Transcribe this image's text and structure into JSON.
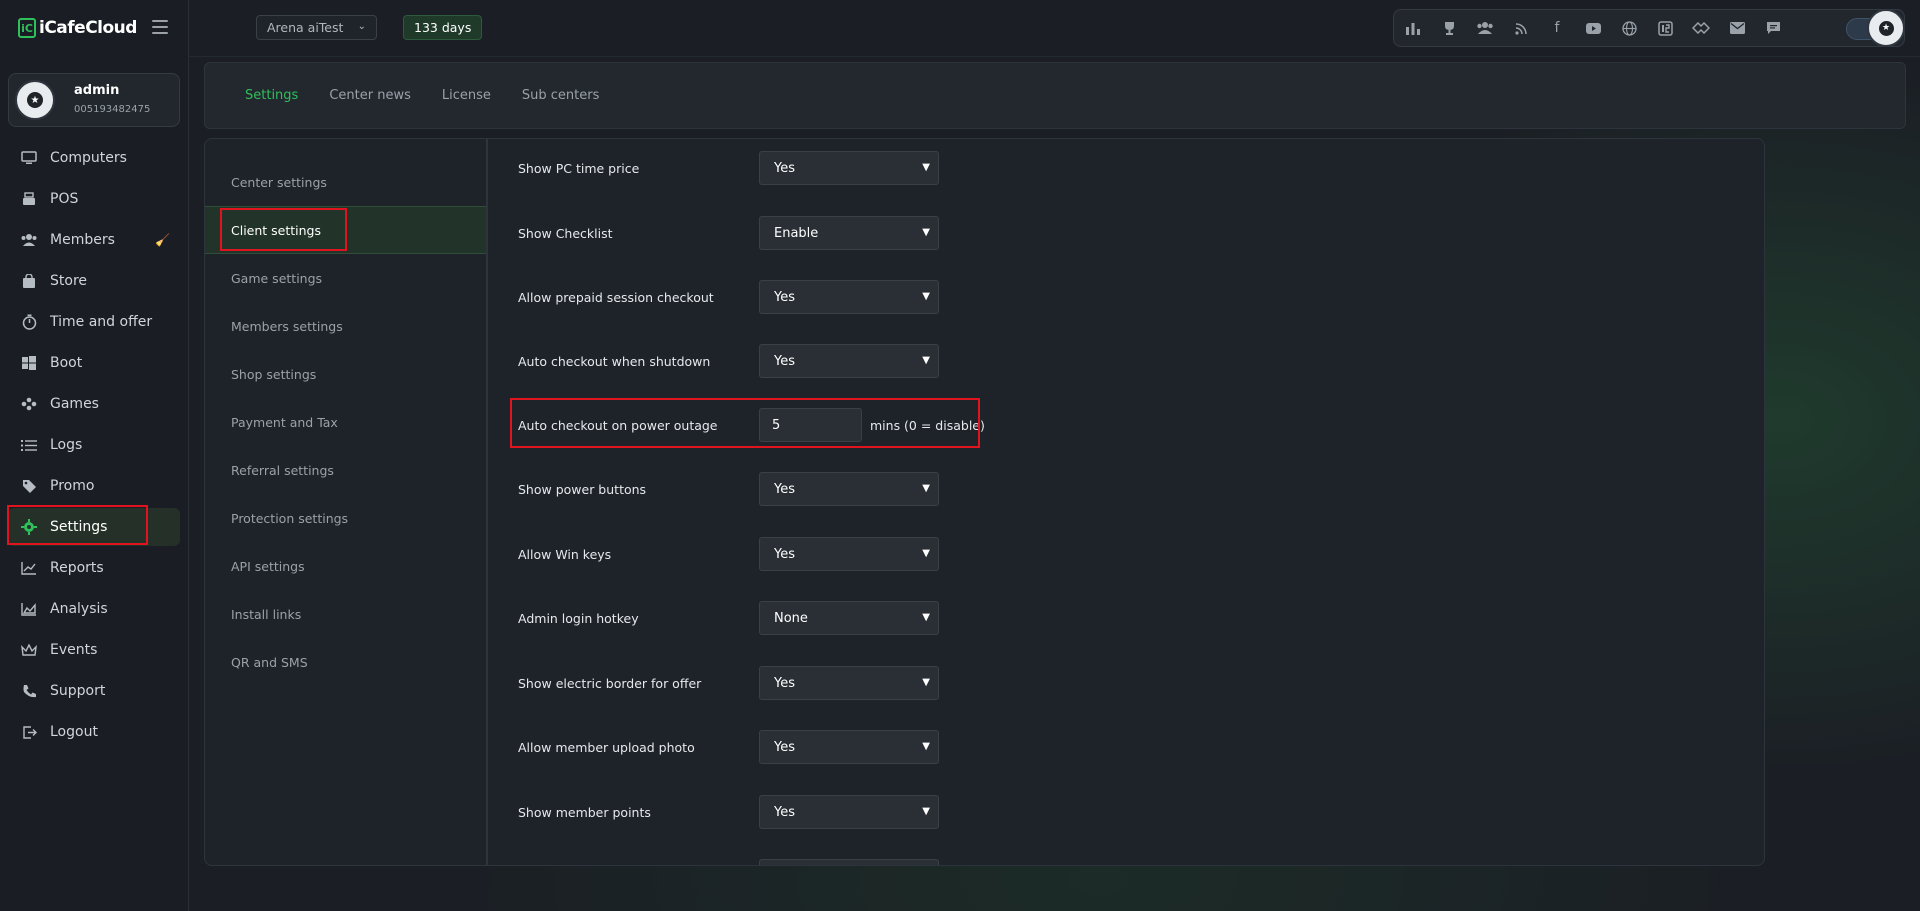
{
  "brand": {
    "mark": "iC",
    "name": "iCafeCloud"
  },
  "user": {
    "name": "admin",
    "id": "005193482475"
  },
  "nav": [
    {
      "label": "Computers",
      "icon": "monitor-icon"
    },
    {
      "label": "POS",
      "icon": "cash-register-icon"
    },
    {
      "label": "Members",
      "icon": "users-icon"
    },
    {
      "label": "Store",
      "icon": "shopping-bag-icon"
    },
    {
      "label": "Time and offer",
      "icon": "stopwatch-icon"
    },
    {
      "label": "Boot",
      "icon": "windows-icon"
    },
    {
      "label": "Games",
      "icon": "gamepad-icon"
    },
    {
      "label": "Logs",
      "icon": "list-icon"
    },
    {
      "label": "Promo",
      "icon": "tag-icon"
    },
    {
      "label": "Settings",
      "icon": "gear-icon"
    },
    {
      "label": "Reports",
      "icon": "line-chart-icon"
    },
    {
      "label": "Analysis",
      "icon": "area-chart-icon"
    },
    {
      "label": "Events",
      "icon": "crown-icon"
    },
    {
      "label": "Support",
      "icon": "phone-icon"
    },
    {
      "label": "Logout",
      "icon": "logout-icon"
    }
  ],
  "topbar": {
    "center_name": "Arena aiTest",
    "days_left": "133 days"
  },
  "tabs": [
    "Settings",
    "Center news",
    "License",
    "Sub centers"
  ],
  "sub_nav": [
    "Center settings",
    "Client settings",
    "Game settings",
    "Members settings",
    "Shop settings",
    "Payment and Tax",
    "Referral settings",
    "Protection settings",
    "API settings",
    "Install links",
    "QR and SMS"
  ],
  "form": {
    "rows": [
      {
        "label": "Show PC time price",
        "value": "Yes"
      },
      {
        "label": "Show Checklist",
        "value": "Enable"
      },
      {
        "label": "Allow prepaid session checkout",
        "value": "Yes"
      },
      {
        "label": "Auto checkout when shutdown",
        "value": "Yes"
      },
      {
        "label": "Auto checkout on power outage",
        "value": "5",
        "suffix": "mins (0 = disable)"
      },
      {
        "label": "Show power buttons",
        "value": "Yes"
      },
      {
        "label": "Allow Win keys",
        "value": "Yes"
      },
      {
        "label": "Admin login hotkey",
        "value": "None"
      },
      {
        "label": "Show electric border for offer",
        "value": "Yes"
      },
      {
        "label": "Allow member upload photo",
        "value": "Yes"
      },
      {
        "label": "Show member points",
        "value": "Yes"
      }
    ]
  },
  "colors": {
    "accent": "#2fbf5b",
    "highlight": "#e0141e",
    "background": "#1b1f25"
  }
}
